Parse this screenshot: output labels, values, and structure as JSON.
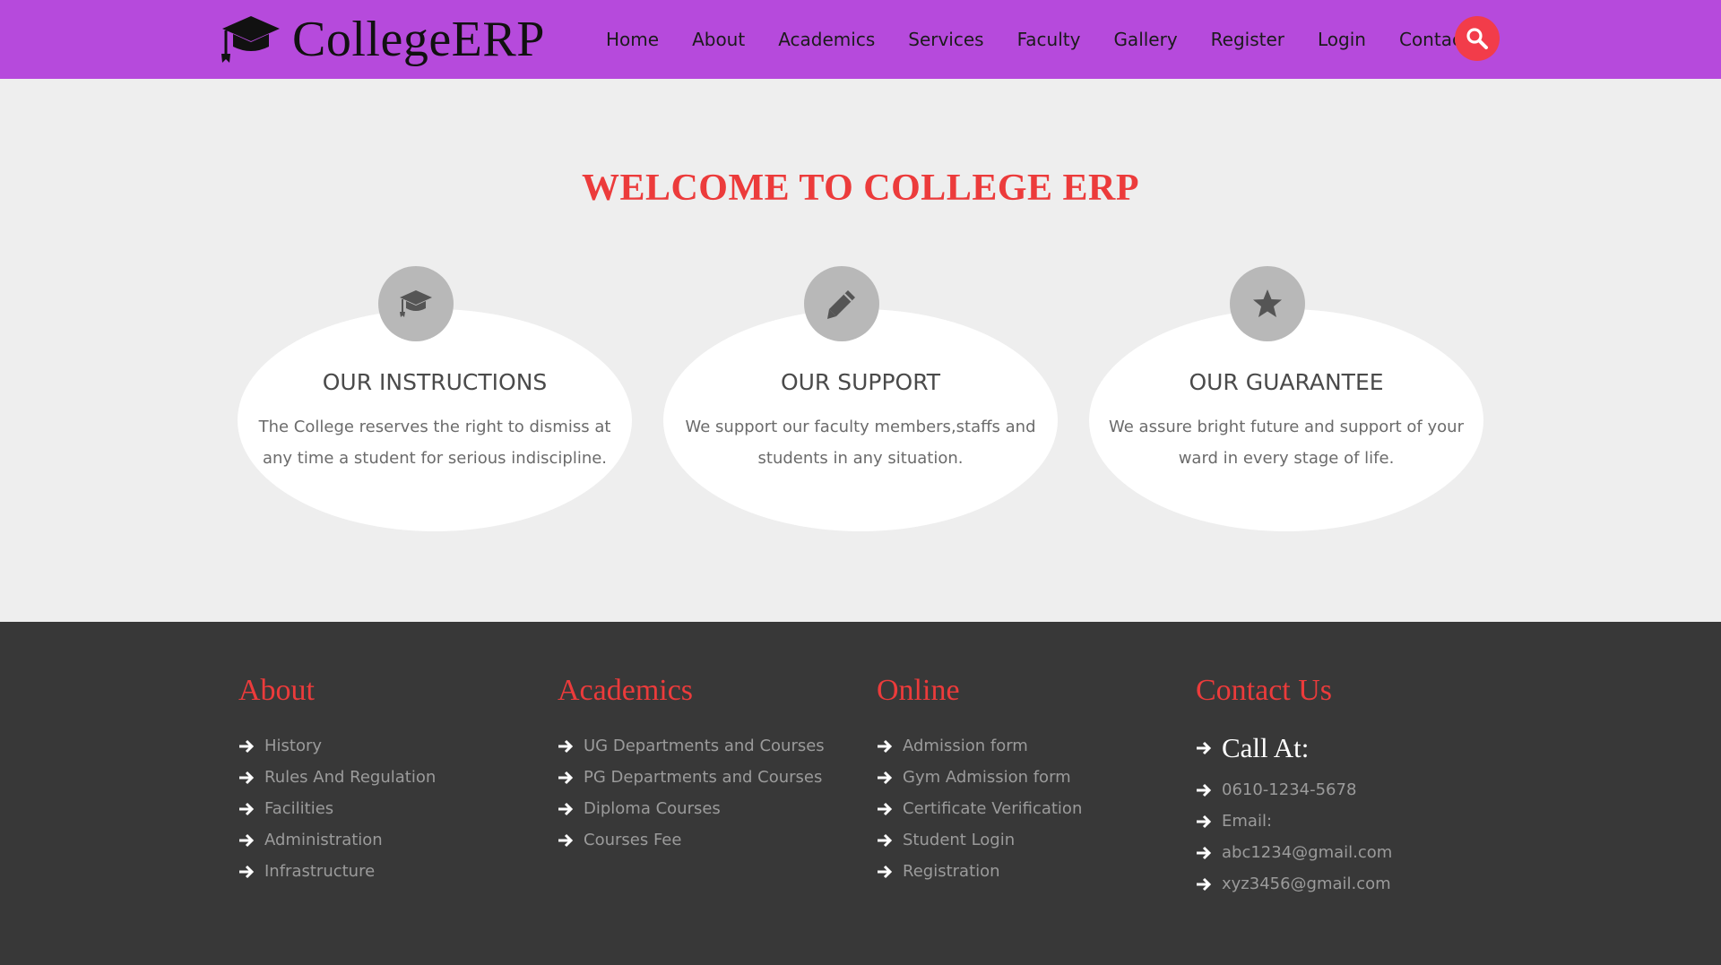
{
  "header": {
    "brand": "CollegeERP",
    "nav": [
      "Home",
      "About",
      "Academics",
      "Services",
      "Faculty",
      "Gallery",
      "Register",
      "Login",
      "Contact"
    ]
  },
  "main": {
    "welcome": "WELCOME TO COLLEGE ERP",
    "features": [
      {
        "icon": "graduation-cap-icon",
        "title": "OUR INSTRUCTIONS",
        "text": "The College reserves the right to dismiss at any time a student for serious indiscipline."
      },
      {
        "icon": "pencil-icon",
        "title": "OUR SUPPORT",
        "text": "We support our faculty members,staffs and students in any situation."
      },
      {
        "icon": "star-icon",
        "title": "OUR GUARANTEE",
        "text": "We assure bright future and support of your ward in every stage of life."
      }
    ]
  },
  "footer": {
    "about": {
      "title": "About",
      "links": [
        "History",
        "Rules And Regulation",
        "Facilities",
        "Administration",
        "Infrastructure"
      ]
    },
    "academics": {
      "title": "Academics",
      "links": [
        "UG Departments and Courses",
        "PG Departments and Courses",
        "Diploma Courses",
        "Courses Fee"
      ]
    },
    "online": {
      "title": "Online",
      "links": [
        "Admission form",
        "Gym Admission form",
        "Certificate Verification",
        "Student Login",
        "Registration"
      ]
    },
    "contact": {
      "title": "Contact Us",
      "call_at": "Call At:",
      "phone": "0610-1234-5678",
      "email_label": "Email:",
      "emails": [
        "abc1234@gmail.com",
        "xyz3456@gmail.com"
      ]
    }
  },
  "colors": {
    "header_bg": "#b64adc",
    "accent_red": "#ec3b3b",
    "search_button": "#f23c4a",
    "footer_bg": "#383838",
    "page_bg": "#eeeeee"
  }
}
